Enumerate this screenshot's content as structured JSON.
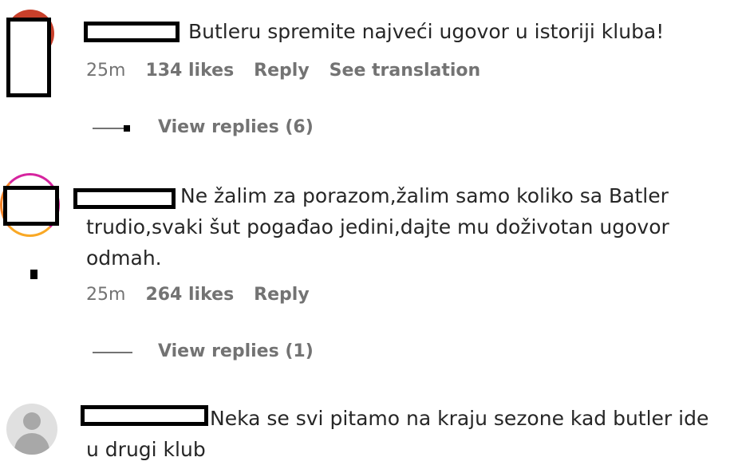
{
  "comments": [
    {
      "text": "Butleru spremite najveći ugovor u istoriji kluba!",
      "time": "25m",
      "likes": "134 likes",
      "reply": "Reply",
      "translate": "See translation",
      "view_replies": "View replies (6)"
    },
    {
      "text": "Ne žalim za porazom,žalim samo koliko sa Batler trudio,svaki šut pogađao jedini,dajte mu doživotan ugovor odmah.",
      "time": "25m",
      "likes": "264 likes",
      "reply": "Reply",
      "view_replies": "View replies (1)"
    },
    {
      "text": "Neka se svi pitamo na kraju sezone kad butler ide u drugi klub"
    }
  ],
  "colors": {
    "text": "#262626",
    "meta": "#737373",
    "redaction": "#000000",
    "story_ring": "#d6249f",
    "avatar_red": "#c8402b",
    "default_avatar": "#c7c7c7"
  }
}
